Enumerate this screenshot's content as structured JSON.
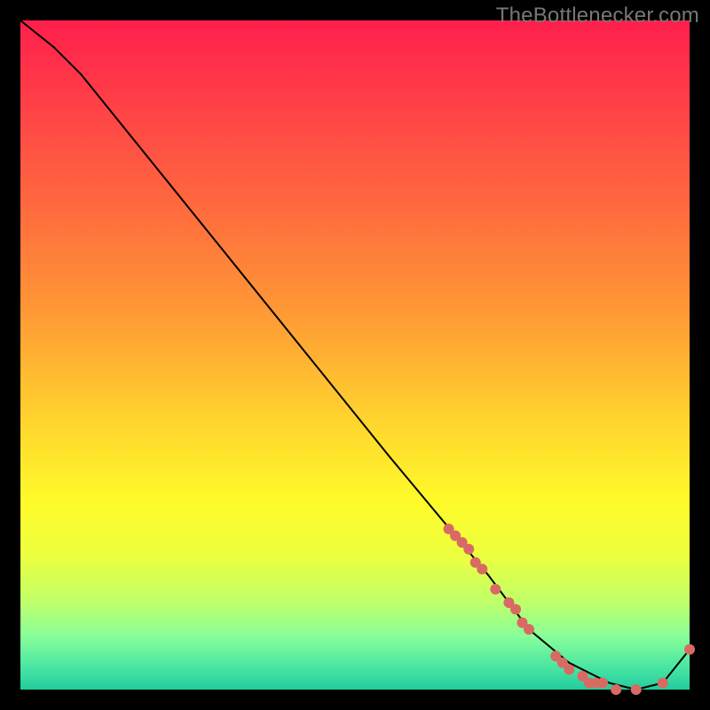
{
  "attribution": "TheBottlenecker.com",
  "chart_data": {
    "type": "line",
    "title": "",
    "xlabel": "",
    "ylabel": "",
    "xlim": [
      0,
      100
    ],
    "ylim": [
      0,
      100
    ],
    "gradient_stops": [
      {
        "pos": 0,
        "color": "#ff1f4c"
      },
      {
        "pos": 12,
        "color": "#ff3f47"
      },
      {
        "pos": 28,
        "color": "#ff6a3e"
      },
      {
        "pos": 44,
        "color": "#ff9a35"
      },
      {
        "pos": 60,
        "color": "#ffd52e"
      },
      {
        "pos": 72,
        "color": "#fffb2a"
      },
      {
        "pos": 80,
        "color": "#ecff3f"
      },
      {
        "pos": 87,
        "color": "#bfff6a"
      },
      {
        "pos": 92,
        "color": "#88ff9a"
      },
      {
        "pos": 97,
        "color": "#45e3a2"
      },
      {
        "pos": 100,
        "color": "#22cc9d"
      }
    ],
    "series": [
      {
        "name": "bottleneck-curve",
        "x": [
          0,
          5,
          9,
          30,
          55,
          70,
          76,
          82,
          88,
          92,
          96,
          100
        ],
        "y": [
          100,
          96,
          92,
          66,
          35,
          17,
          9,
          4,
          1,
          0,
          1,
          6
        ]
      }
    ],
    "markers": {
      "name": "highlight-points",
      "color": "#d86a64",
      "radius": 6,
      "points": [
        {
          "x": 64,
          "y": 24
        },
        {
          "x": 65,
          "y": 23
        },
        {
          "x": 66,
          "y": 22
        },
        {
          "x": 67,
          "y": 21
        },
        {
          "x": 68,
          "y": 19
        },
        {
          "x": 69,
          "y": 18
        },
        {
          "x": 71,
          "y": 15
        },
        {
          "x": 73,
          "y": 13
        },
        {
          "x": 74,
          "y": 12
        },
        {
          "x": 75,
          "y": 10
        },
        {
          "x": 76,
          "y": 9
        },
        {
          "x": 80,
          "y": 5
        },
        {
          "x": 81,
          "y": 4
        },
        {
          "x": 82,
          "y": 3
        },
        {
          "x": 84,
          "y": 2
        },
        {
          "x": 85,
          "y": 1
        },
        {
          "x": 86,
          "y": 1
        },
        {
          "x": 87,
          "y": 1
        },
        {
          "x": 89,
          "y": 0
        },
        {
          "x": 92,
          "y": 0
        },
        {
          "x": 96,
          "y": 1
        },
        {
          "x": 100,
          "y": 6
        }
      ]
    }
  }
}
